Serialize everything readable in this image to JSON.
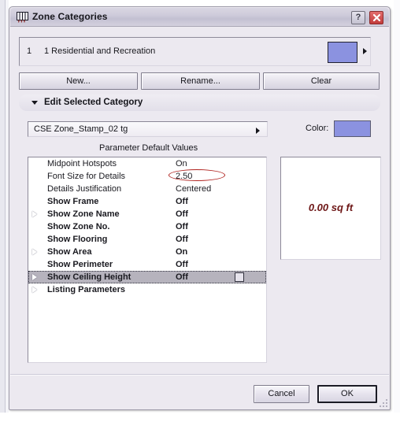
{
  "window": {
    "title": "Zone Categories",
    "icon": "zone-stamp-icon",
    "help_button": "?",
    "close_button": "close-icon"
  },
  "category_row": {
    "index": "1",
    "name": "1 Residential and Recreation",
    "swatch_color": "#8b92e0",
    "expand_arrow": "triangle-right-icon"
  },
  "buttons": {
    "new": "New...",
    "rename": "Rename...",
    "clear": "Clear"
  },
  "section": {
    "label": "Edit Selected Category",
    "triangle": "triangle-down-icon"
  },
  "stamp": {
    "selected": "CSE Zone_Stamp_02 tg",
    "color_label": "Color:",
    "color_value": "#8b92e0"
  },
  "params": {
    "title": "Parameter Default Values",
    "rows": [
      {
        "name": "Midpoint Hotspots",
        "value": "On",
        "bold": false,
        "expandable": false,
        "selected": false,
        "checkbox": false,
        "annotated": false
      },
      {
        "name": "Font Size for Details",
        "value": "2.50",
        "bold": false,
        "expandable": false,
        "selected": false,
        "checkbox": false,
        "annotated": true
      },
      {
        "name": "Details Justification",
        "value": "Centered",
        "bold": false,
        "expandable": false,
        "selected": false,
        "checkbox": false,
        "annotated": false
      },
      {
        "name": "Show Frame",
        "value": "Off",
        "bold": true,
        "expandable": false,
        "selected": false,
        "checkbox": false,
        "annotated": false
      },
      {
        "name": "Show Zone Name",
        "value": "Off",
        "bold": true,
        "expandable": true,
        "selected": false,
        "checkbox": false,
        "annotated": false
      },
      {
        "name": "Show Zone No.",
        "value": "Off",
        "bold": true,
        "expandable": false,
        "selected": false,
        "checkbox": false,
        "annotated": false
      },
      {
        "name": "Show Flooring",
        "value": "Off",
        "bold": true,
        "expandable": false,
        "selected": false,
        "checkbox": false,
        "annotated": false
      },
      {
        "name": "Show Area",
        "value": "On",
        "bold": true,
        "expandable": true,
        "selected": false,
        "checkbox": false,
        "annotated": false
      },
      {
        "name": "Show Perimeter",
        "value": "Off",
        "bold": true,
        "expandable": false,
        "selected": false,
        "checkbox": false,
        "annotated": false
      },
      {
        "name": "Show Ceiling Height",
        "value": "Off",
        "bold": true,
        "expandable": true,
        "selected": true,
        "checkbox": true,
        "annotated": false
      },
      {
        "name": "Listing Parameters",
        "value": "",
        "bold": true,
        "expandable": true,
        "selected": false,
        "checkbox": false,
        "annotated": false
      }
    ],
    "annotation_color": "#b0231f"
  },
  "preview": {
    "text": "0.00 sq ft",
    "text_color": "#6d1616"
  },
  "footer": {
    "cancel": "Cancel",
    "ok": "OK"
  }
}
